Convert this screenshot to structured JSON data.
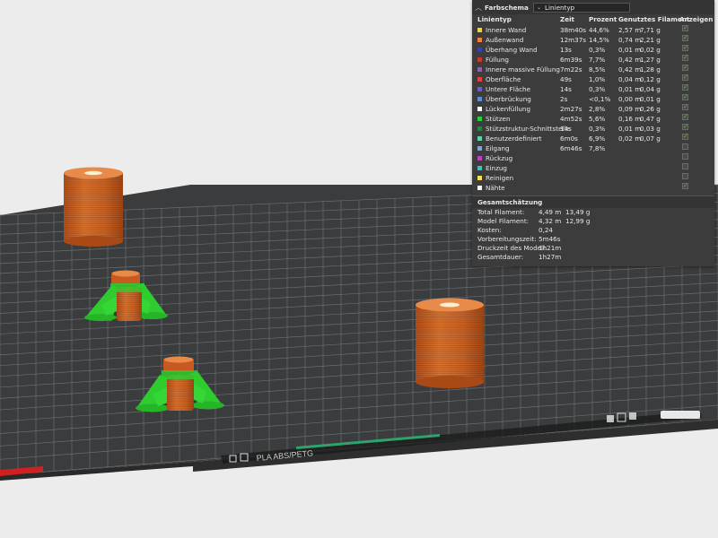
{
  "legend": {
    "color_scheme_label": "Farbschema",
    "color_scheme_value": "Linientyp",
    "headers": {
      "type": "Linientyp",
      "time": "Zeit",
      "percent": "Prozent",
      "filament": "Genutztes Filament",
      "show": "Anzeigen"
    },
    "rows": [
      {
        "name": "Innere Wand",
        "color": "#f4d03f",
        "time": "38m40s",
        "percent": "44,6%",
        "length": "2,57 m",
        "weight": "7,71 g",
        "show": true
      },
      {
        "name": "Außenwand",
        "color": "#f08040",
        "time": "12m37s",
        "percent": "14,5%",
        "length": "0,74 m",
        "weight": "2,21 g",
        "show": true
      },
      {
        "name": "Überhang Wand",
        "color": "#3040c0",
        "time": "13s",
        "percent": "0,3%",
        "length": "0,01 m",
        "weight": "0,02 g",
        "show": true
      },
      {
        "name": "Füllung",
        "color": "#c0392b",
        "time": "6m39s",
        "percent": "7,7%",
        "length": "0,42 m",
        "weight": "1,27 g",
        "show": true
      },
      {
        "name": "Innere massive Füllung",
        "color": "#9b59b6",
        "time": "7m22s",
        "percent": "8,5%",
        "length": "0,42 m",
        "weight": "1,28 g",
        "show": true
      },
      {
        "name": "Oberfläche",
        "color": "#e04040",
        "time": "49s",
        "percent": "1,0%",
        "length": "0,04 m",
        "weight": "0,12 g",
        "show": true
      },
      {
        "name": "Untere Fläche",
        "color": "#6a5acd",
        "time": "14s",
        "percent": "0,3%",
        "length": "0,01 m",
        "weight": "0,04 g",
        "show": true
      },
      {
        "name": "Überbrückung",
        "color": "#5d8fc9",
        "time": "2s",
        "percent": "<0,1%",
        "length": "0,00 m",
        "weight": "0,01 g",
        "show": true
      },
      {
        "name": "Lückenfüllung",
        "color": "#ffffff",
        "time": "2m27s",
        "percent": "2,8%",
        "length": "0,09 m",
        "weight": "0,26 g",
        "show": true
      },
      {
        "name": "Stützen",
        "color": "#2ecc40",
        "time": "4m52s",
        "percent": "5,6%",
        "length": "0,16 m",
        "weight": "0,47 g",
        "show": true
      },
      {
        "name": "Stützstruktur-Schnittstelle",
        "color": "#1e8a3c",
        "time": "14s",
        "percent": "0,3%",
        "length": "0,01 m",
        "weight": "0,03 g",
        "show": true
      },
      {
        "name": "Benutzerdefiniert",
        "color": "#5fd3a4",
        "time": "6m0s",
        "percent": "6,9%",
        "length": "0,02 m",
        "weight": "0,07 g",
        "show": true
      },
      {
        "name": "Eilgang",
        "color": "#7aa7d8",
        "time": "6m46s",
        "percent": "7,8%",
        "length": "",
        "weight": "",
        "show": false
      },
      {
        "name": "Rückzug",
        "color": "#c040c0",
        "time": "",
        "percent": "",
        "length": "",
        "weight": "",
        "show": false
      },
      {
        "name": "Einzug",
        "color": "#40c0c0",
        "time": "",
        "percent": "",
        "length": "",
        "weight": "",
        "show": false
      },
      {
        "name": "Reinigen",
        "color": "#f1e05a",
        "time": "",
        "percent": "",
        "length": "",
        "weight": "",
        "show": false
      },
      {
        "name": "Nähte",
        "color": "#f5f5f5",
        "time": "",
        "percent": "",
        "length": "",
        "weight": "",
        "show": true
      }
    ],
    "summary": {
      "title": "Gesamtschätzung",
      "rows": [
        {
          "label": "Total Filament:",
          "v1": "4,49 m",
          "v2": "13,49 g"
        },
        {
          "label": "Model Filament:",
          "v1": "4,32 m",
          "v2": "12,99 g"
        },
        {
          "label": "Kosten:",
          "v1": "0,24",
          "v2": ""
        },
        {
          "label": "Vorbereitungszeit:",
          "v1": "5m46s",
          "v2": ""
        },
        {
          "label": "Druckzeit des Modell:",
          "v1": "1h21m",
          "v2": ""
        },
        {
          "label": "Gesamtdauer:",
          "v1": "1h27m",
          "v2": ""
        }
      ]
    }
  },
  "plate": {
    "label": "PLA ABS/PETG",
    "background_color": "#3a3c3e",
    "grid_color": "#6b6e70",
    "model_color": "#d86a2a",
    "support_color": "#2ecc2e"
  }
}
